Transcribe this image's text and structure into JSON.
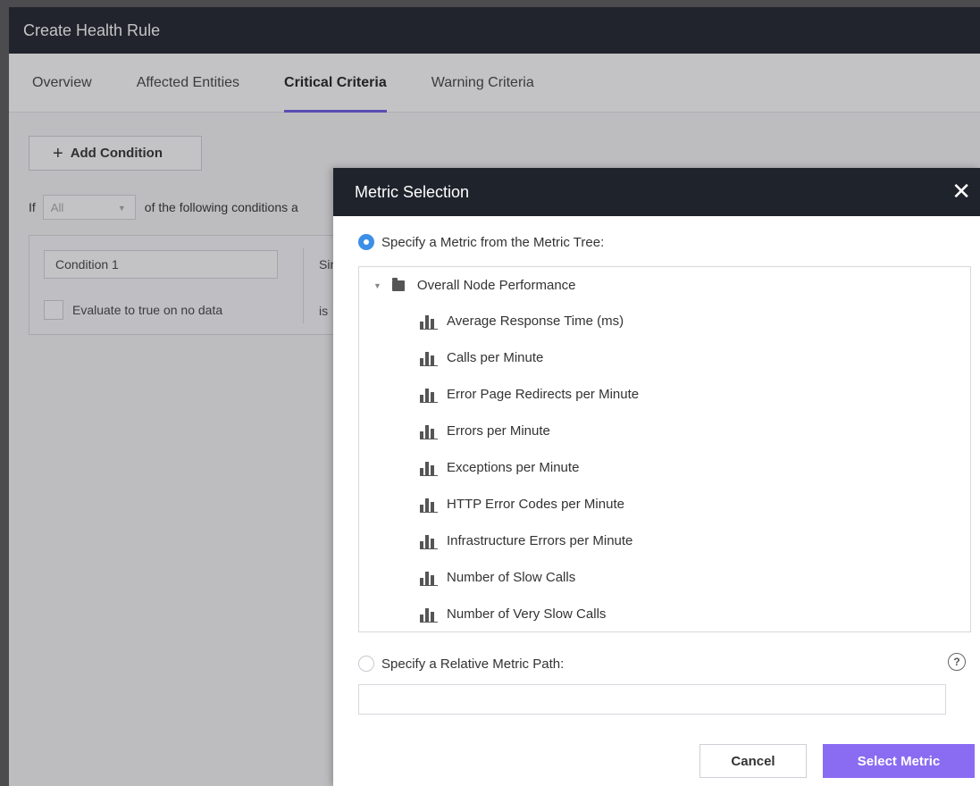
{
  "window": {
    "title": "Create Health Rule"
  },
  "tabs": [
    {
      "label": "Overview",
      "active": false
    },
    {
      "label": "Affected Entities",
      "active": false
    },
    {
      "label": "Critical Criteria",
      "active": true
    },
    {
      "label": "Warning Criteria",
      "active": false
    }
  ],
  "conditions": {
    "add_button": "Add Condition",
    "if_label": "If",
    "if_select_value": "All",
    "if_suffix": "of the following conditions a",
    "condition_name": "Condition 1",
    "side_text": "Sin",
    "evaluate_label": "Evaluate to true on no data",
    "is_label": "is"
  },
  "modal": {
    "title": "Metric Selection",
    "option_tree_label": "Specify a Metric from the Metric Tree:",
    "tree_root": "Overall Node Performance",
    "metrics": [
      "Average Response Time (ms)",
      "Calls per Minute",
      "Error Page Redirects per Minute",
      "Errors per Minute",
      "Exceptions per Minute",
      "HTTP Error Codes per Minute",
      "Infrastructure Errors per Minute",
      "Number of Slow Calls",
      "Number of Very Slow Calls"
    ],
    "option_path_label": "Specify a Relative Metric Path:",
    "path_value": "",
    "help_glyph": "?",
    "cancel_label": "Cancel",
    "select_label": "Select Metric"
  },
  "colors": {
    "accent": "#6c5ce7",
    "primary_button": "#8a6cf2",
    "radio_selected": "#3c8fe6",
    "header_bg": "#1f232c"
  }
}
